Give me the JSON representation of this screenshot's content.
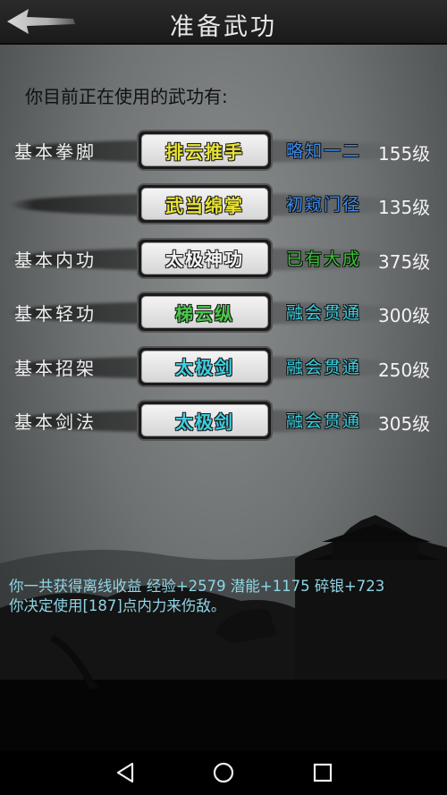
{
  "header": {
    "title": "准备武功",
    "back_icon": "back-arrow-icon"
  },
  "intro_text": "你目前正在使用的武功有:",
  "skills": [
    {
      "category": "基本拳脚",
      "name": "排云推手",
      "name_color": "#e8e234",
      "level_text": "略知一二",
      "level_color": "#3c8cf0",
      "level_num": "155级"
    },
    {
      "category": "",
      "name": "武当绵掌",
      "name_color": "#e8e234",
      "level_text": "初窥门径",
      "level_color": "#3c8cf0",
      "level_num": "135级"
    },
    {
      "category": "基本内功",
      "name": "太极神功",
      "name_color": "#f4f4f4",
      "level_text": "已有大成",
      "level_color": "#37c036",
      "level_num": "375级"
    },
    {
      "category": "基本轻功",
      "name": "梯云纵",
      "name_color": "#4ac84a",
      "level_text": "融会贯通",
      "level_color": "#3ecfe0",
      "level_num": "300级"
    },
    {
      "category": "基本招架",
      "name": "太极剑",
      "name_color": "#3ecfe0",
      "level_text": "融会贯通",
      "level_color": "#3ecfe0",
      "level_num": "250级"
    },
    {
      "category": "基本剑法",
      "name": "太极剑",
      "name_color": "#3ecfe0",
      "level_text": "融会贯通",
      "level_color": "#3ecfe0",
      "level_num": "305级"
    }
  ],
  "log": [
    "你一共获得离线收益 经验+2579 潜能+1175 碎银+723",
    "你决定使用[187]点内力来伤敌。"
  ],
  "navbar": {
    "back": "triangle-back-icon",
    "home": "circle-home-icon",
    "recents": "square-recents-icon"
  }
}
